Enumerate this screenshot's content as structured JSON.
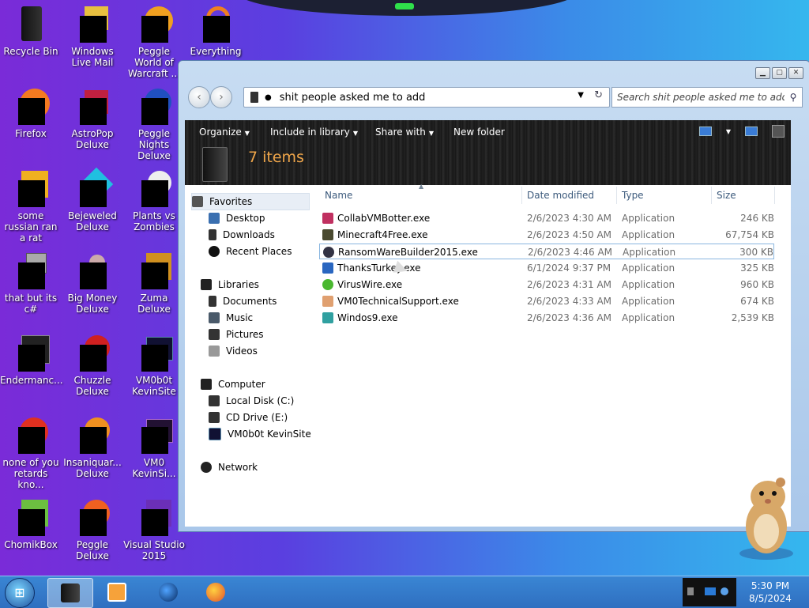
{
  "desktop": {
    "icons": [
      {
        "label": "Recycle Bin"
      },
      {
        "label": "Windows Live Mail"
      },
      {
        "label": "Peggle World of Warcraft ..."
      },
      {
        "label": "Everything"
      },
      {
        "label": "Firefox"
      },
      {
        "label": "AstroPop Deluxe"
      },
      {
        "label": "Peggle Nights Deluxe"
      },
      {
        "label": "some russian ran a rat"
      },
      {
        "label": "Bejeweled Deluxe"
      },
      {
        "label": "Plants vs Zombies"
      },
      {
        "label": "that but its c#"
      },
      {
        "label": "Big Money Deluxe"
      },
      {
        "label": "Zuma Deluxe"
      },
      {
        "label": "Endermanc..."
      },
      {
        "label": "Chuzzle Deluxe"
      },
      {
        "label": "VM0b0t KevinSite"
      },
      {
        "label": "none of you retards kno..."
      },
      {
        "label": "Insaniquar... Deluxe"
      },
      {
        "label": "VM0 KevinSi..."
      },
      {
        "label": "ChomikBox"
      },
      {
        "label": "Peggle Deluxe"
      },
      {
        "label": "Visual Studio 2015"
      }
    ]
  },
  "window": {
    "address": "shit people asked me to add",
    "search_placeholder": "Search shit people asked me to add",
    "controls": {
      "minimize": "▁",
      "maximize": "▢",
      "close": "✕"
    },
    "toolbar": {
      "organize": "Organize",
      "include": "Include in library",
      "share": "Share with",
      "new_folder": "New folder"
    },
    "item_count": "7 items",
    "nav": {
      "favorites": "Favorites",
      "desktop": "Desktop",
      "downloads": "Downloads",
      "recent": "Recent Places",
      "libraries": "Libraries",
      "documents": "Documents",
      "music": "Music",
      "pictures": "Pictures",
      "videos": "Videos",
      "computer": "Computer",
      "local_disk": "Local Disk (C:)",
      "cd_drive": "CD Drive (E:)",
      "kevinsite": "VM0b0t KevinSite",
      "network": "Network"
    },
    "columns": {
      "name": "Name",
      "date": "Date modified",
      "type": "Type",
      "size": "Size"
    },
    "files": [
      {
        "name": "CollabVMBotter.exe",
        "date": "2/6/2023 4:30 AM",
        "type": "Application",
        "size": "246 KB"
      },
      {
        "name": "Minecraft4Free.exe",
        "date": "2/6/2023 4:50 AM",
        "type": "Application",
        "size": "67,754 KB"
      },
      {
        "name": "RansomWareBuilder2015.exe",
        "date": "2/6/2023 4:46 AM",
        "type": "Application",
        "size": "300 KB"
      },
      {
        "name": "ThanksTurkey.exe",
        "date": "6/1/2024 9:37 PM",
        "type": "Application",
        "size": "325 KB"
      },
      {
        "name": "VirusWire.exe",
        "date": "2/6/2023 4:31 AM",
        "type": "Application",
        "size": "960 KB"
      },
      {
        "name": "VM0TechnicalSupport.exe",
        "date": "2/6/2023 4:33 AM",
        "type": "Application",
        "size": "674 KB"
      },
      {
        "name": "Windos9.exe",
        "date": "2/6/2023 4:36 AM",
        "type": "Application",
        "size": "2,539 KB"
      }
    ]
  },
  "taskbar": {
    "time": "5:30 PM",
    "date": "8/5/2024"
  },
  "colors": {
    "accent_orange": "#f0a64a",
    "taskbar": "#2f6fc0"
  }
}
